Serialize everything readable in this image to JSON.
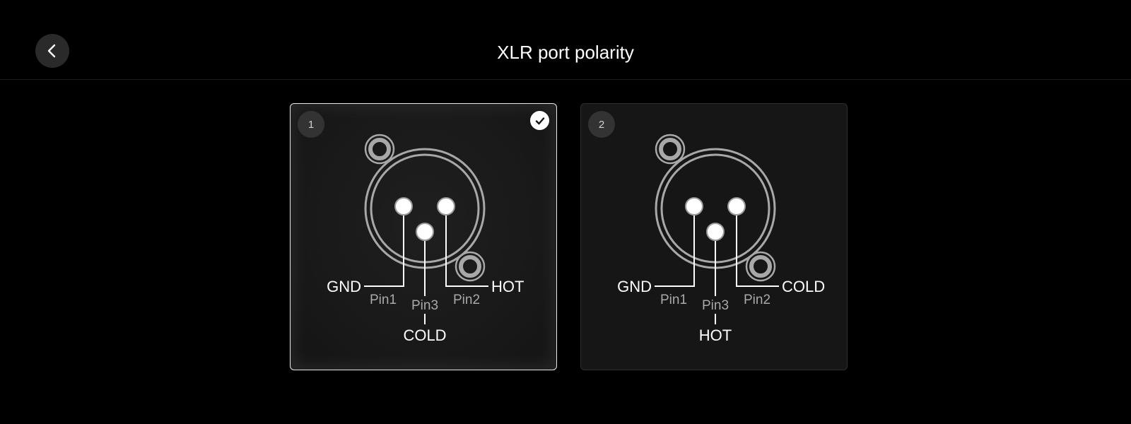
{
  "header": {
    "title": "XLR port polarity",
    "back_icon": "chevron-left-icon"
  },
  "options": [
    {
      "number": "1",
      "selected": true,
      "gnd_label": "GND",
      "right_label": "HOT",
      "bottom_label": "COLD",
      "pin1_label": "Pin1",
      "pin2_label": "Pin2",
      "pin3_label": "Pin3"
    },
    {
      "number": "2",
      "selected": false,
      "gnd_label": "GND",
      "right_label": "COLD",
      "bottom_label": "HOT",
      "pin1_label": "Pin1",
      "pin2_label": "Pin2",
      "pin3_label": "Pin3"
    }
  ],
  "colors": {
    "background": "#000000",
    "card_selected_border": "#e8e8e8",
    "pin_label": "#a9a9a9",
    "ring": "#a8a8a8"
  },
  "icons": {
    "selected": "check-circle-icon"
  }
}
